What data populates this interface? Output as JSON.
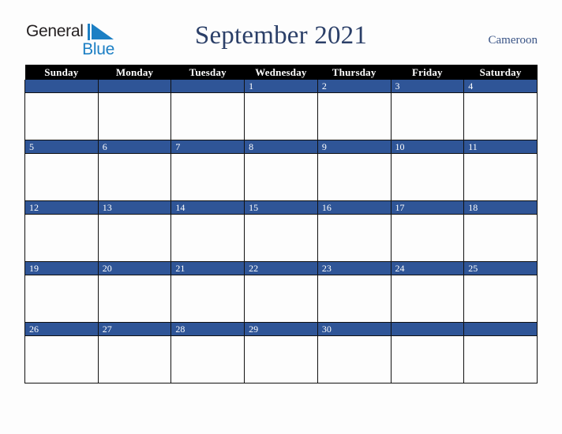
{
  "brand": {
    "name_part1": "General",
    "name_part2": "Blue",
    "mark_color": "#1c7fc4",
    "text_color": "#231f20"
  },
  "header": {
    "title": "September 2021",
    "country": "Cameroon",
    "title_color": "#2b3f68",
    "country_color": "#3a5486"
  },
  "calendar": {
    "weekday_headers": [
      "Sunday",
      "Monday",
      "Tuesday",
      "Wednesday",
      "Thursday",
      "Friday",
      "Saturday"
    ],
    "header_bg": "#000000",
    "header_fg": "#ffffff",
    "daynum_bg": "#2f5597",
    "daynum_fg": "#ffffff",
    "cell_bg": "#fdfdfd",
    "grid_line": "#111111",
    "weeks": [
      [
        "",
        "",
        "",
        "1",
        "2",
        "3",
        "4"
      ],
      [
        "5",
        "6",
        "7",
        "8",
        "9",
        "10",
        "11"
      ],
      [
        "12",
        "13",
        "14",
        "15",
        "16",
        "17",
        "18"
      ],
      [
        "19",
        "20",
        "21",
        "22",
        "23",
        "24",
        "25"
      ],
      [
        "26",
        "27",
        "28",
        "29",
        "30",
        "",
        ""
      ]
    ]
  }
}
